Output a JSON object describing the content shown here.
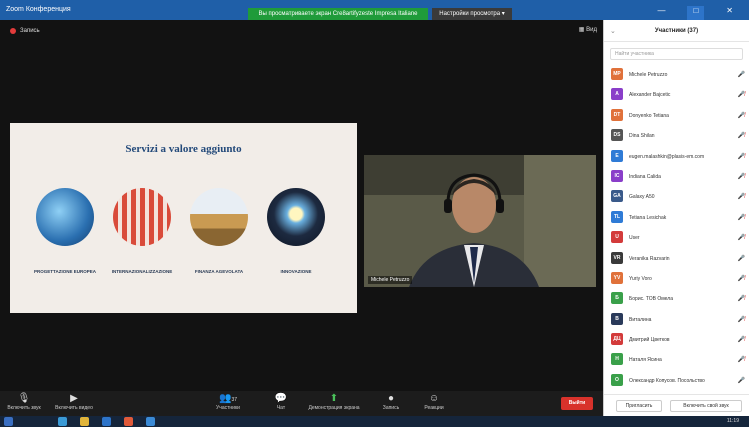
{
  "window": {
    "title": "Zoom Конференция",
    "controls": [
      "—",
      "□",
      "✕"
    ]
  },
  "share_bar": {
    "text": "Вы просматриваете экран Cre8artifyzeste Impresa Italiane",
    "view_options": "Настройки просмотра ▾"
  },
  "meeting": {
    "recording": "Запись",
    "view": "Вид"
  },
  "slide": {
    "title": "Servizi a valore aggiunto",
    "services": [
      {
        "label": "PROGETTAZIONE EUROPEA",
        "color": "#2a6fb0"
      },
      {
        "label": "INTERNAZIONALIZZAZIONE",
        "color": "#c23a2f"
      },
      {
        "label": "FINANZA AGEVOLATA",
        "color": "#c99a52"
      },
      {
        "label": "INNOVAZIONE",
        "color": "#1d2a40"
      }
    ]
  },
  "video": {
    "participant": "Michele Petruzzo"
  },
  "toolbar": {
    "items": [
      {
        "label": "Включить звук",
        "icon": "mic-icon"
      },
      {
        "label": "Включить видео",
        "icon": "camera-icon"
      },
      {
        "label": "Участники",
        "icon": "participants-icon",
        "count": "37"
      },
      {
        "label": "Чат",
        "icon": "chat-icon"
      },
      {
        "label": "Демонстрация экрана",
        "icon": "share-screen-icon"
      },
      {
        "label": "Запись",
        "icon": "record-icon"
      },
      {
        "label": "Реакции",
        "icon": "reactions-icon"
      }
    ],
    "end_label": "Выйти"
  },
  "panel": {
    "title": "Участники (37)",
    "search_placeholder": "Найти участника",
    "participants": [
      {
        "initials": "MP",
        "name": "Michele Petruzzo",
        "color": "#e0713a",
        "muted": false
      },
      {
        "initials": "A",
        "name": "Alexander Bajcetic",
        "color": "#8a3ec9",
        "muted": true
      },
      {
        "initials": "DT",
        "name": "Donyenko Tetiana",
        "color": "#e0713a",
        "muted": true
      },
      {
        "initials": "DS",
        "name": "Dina Shilan",
        "color": "#555555",
        "muted": true
      },
      {
        "initials": "E",
        "name": "eugen.malashkin@plasis-em.com",
        "color": "#2f7bd6",
        "muted": true
      },
      {
        "initials": "IC",
        "name": "Indiana Calida",
        "color": "#8a3ec9",
        "muted": true
      },
      {
        "initials": "GA",
        "name": "Galaxy A50",
        "color": "#3a5a8a",
        "muted": true
      },
      {
        "initials": "TL",
        "name": "Tetiana Lesichak",
        "color": "#2f7bd6",
        "muted": true
      },
      {
        "initials": "U",
        "name": "User",
        "color": "#d33b3b",
        "muted": true
      },
      {
        "initials": "VR",
        "name": "Veranika Razvarin",
        "color": "#3a3a3a",
        "muted": false
      },
      {
        "initials": "YV",
        "name": "Yuriy Voro",
        "color": "#e0713a",
        "muted": true
      },
      {
        "initials": "Б",
        "name": "Борис. ТОВ Омела",
        "color": "#3aa04a",
        "muted": true
      },
      {
        "initials": "В",
        "name": "Виталина",
        "color": "#2a3a5a",
        "muted": true
      },
      {
        "initials": "ДЦ",
        "name": "Дмитрий Цветков",
        "color": "#d33b3b",
        "muted": true
      },
      {
        "initials": "Н",
        "name": "Наталя Ясина",
        "color": "#3aa04a",
        "muted": true
      },
      {
        "initials": "О",
        "name": "Олександр Копусов. Посольство",
        "color": "#3aa04a",
        "muted": false
      }
    ],
    "invite_label": "Пригласить",
    "unmute_label": "Включить свой звук"
  },
  "taskbar": {
    "time": "11:19"
  }
}
